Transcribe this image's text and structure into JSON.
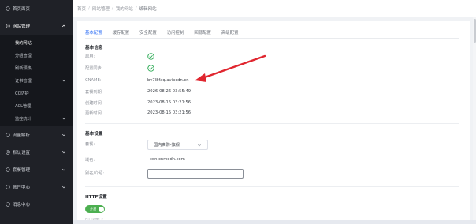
{
  "sidebar": {
    "items": [
      {
        "label": "首页面页",
        "icon": "home-icon"
      },
      {
        "label": "网站管理",
        "icon": "globe-icon"
      },
      {
        "label": "流量解析",
        "icon": "flow-icon"
      },
      {
        "label": "默认设置",
        "icon": "settings-icon"
      },
      {
        "label": "套餐管理",
        "icon": "package-icon"
      },
      {
        "label": "账户中心",
        "icon": "account-icon"
      },
      {
        "label": "消息中心",
        "icon": "message-icon"
      }
    ],
    "submenu": [
      {
        "label": "我的网站",
        "active": true
      },
      {
        "label": "分组管理"
      },
      {
        "label": "刷新预热"
      },
      {
        "label": "证书管理"
      },
      {
        "label": "CC防护"
      },
      {
        "label": "ACL管理"
      },
      {
        "label": "监控统计"
      }
    ]
  },
  "breadcrumb": {
    "items": [
      "首页",
      "网站管理",
      "我的网站",
      "编辑网站"
    ]
  },
  "tabs": [
    {
      "label": "基本配置",
      "active": true
    },
    {
      "label": "缓存配置"
    },
    {
      "label": "安全配置"
    },
    {
      "label": "访问控制"
    },
    {
      "label": "回源配置"
    },
    {
      "label": "高级配置"
    }
  ],
  "basic_info": {
    "title": "基本信息",
    "rows": [
      {
        "label": "启用:",
        "value": ""
      },
      {
        "label": "配置同步:",
        "value": ""
      },
      {
        "label": "CNAME:",
        "value": "bv7l8faq.avipcdn.cn"
      },
      {
        "label": "套餐到期:",
        "value": "2026-08-26 03:55:49"
      },
      {
        "label": "创建时间:",
        "value": "2023-08-15 03:21:56"
      },
      {
        "label": "更新时间:",
        "value": "2023-08-15 03:21:56"
      }
    ]
  },
  "basic_settings": {
    "title": "基本设置",
    "package_label": "套餐:",
    "package_value": "国内高防-旗舰",
    "domain_label": "域名:",
    "domain_value": "cdn.cnmodn.com",
    "remark_label": "别名/介绍:",
    "remark_value": ""
  },
  "http_settings": {
    "title": "HTTP设置",
    "toggle_label": "开启",
    "faded_label": "HTTP端口:"
  },
  "colors": {
    "sidebar_bg": "#1f2127",
    "accent": "#2d6ef5",
    "check": "#25a84f",
    "annotation_arrow": "#e0262f"
  }
}
